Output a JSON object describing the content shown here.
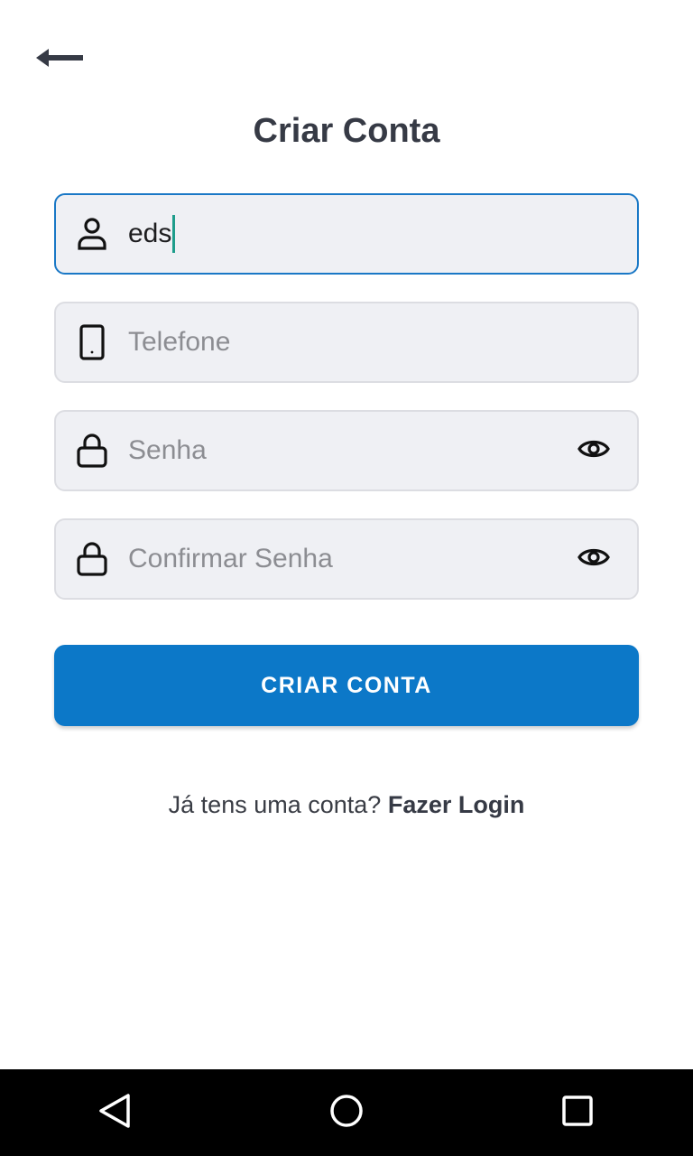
{
  "header": {
    "back_icon": "arrow-left-icon",
    "title": "Criar Conta"
  },
  "form": {
    "name": {
      "icon": "person-icon",
      "value": "eds",
      "placeholder": ""
    },
    "phone": {
      "icon": "smartphone-icon",
      "value": "",
      "placeholder": "Telefone"
    },
    "password": {
      "icon": "lock-icon",
      "value": "",
      "placeholder": "Senha",
      "toggle_icon": "eye-icon"
    },
    "confirm_password": {
      "icon": "lock-icon",
      "value": "",
      "placeholder": "Confirmar Senha",
      "toggle_icon": "eye-icon"
    },
    "submit_label": "CRIAR CONTA"
  },
  "footer": {
    "question": "Já tens uma conta?",
    "link": "Fazer Login"
  },
  "system_nav": {
    "back_icon": "triangle-back-icon",
    "home_icon": "circle-home-icon",
    "recents_icon": "square-recents-icon"
  },
  "colors": {
    "accent": "#0c78c8",
    "title": "#363a45",
    "field_bg": "#eff0f4",
    "caret": "#1e9d8b"
  }
}
